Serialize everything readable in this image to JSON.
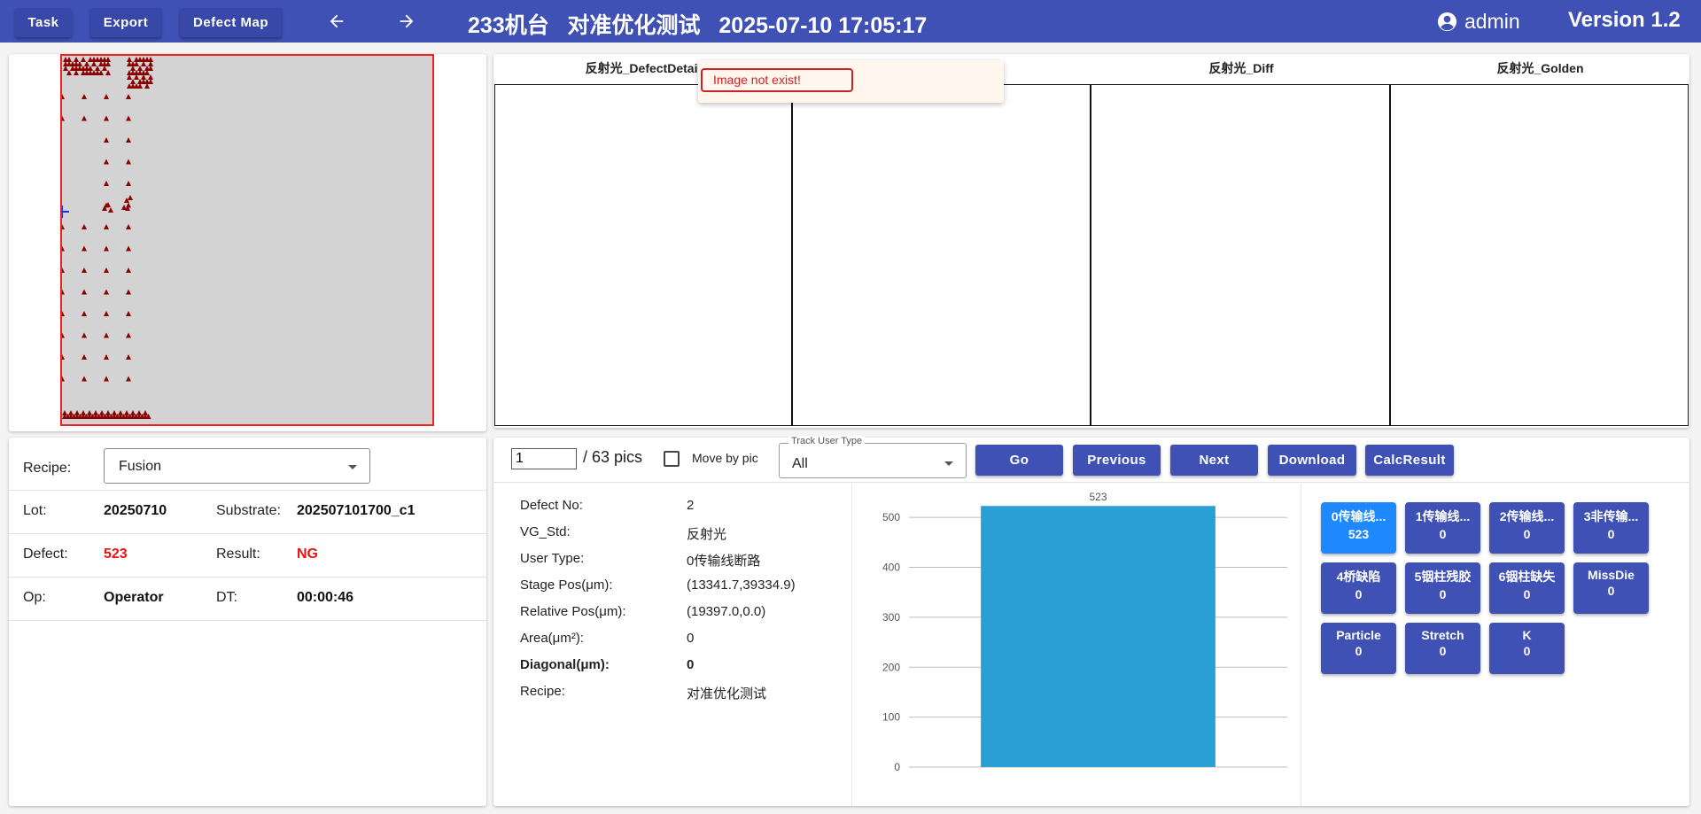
{
  "header": {
    "task_label": "Task",
    "export_label": "Export",
    "defect_map_label": "Defect Map",
    "title": "233机台   对准优化测试   2025-07-10 17:05:17",
    "user": "admin",
    "version": "Version 1.2",
    "background_color": "#3f51b5"
  },
  "info": {
    "recipe_label": "Recipe:",
    "recipe_value": "Fusion",
    "lot_label": "Lot:",
    "lot_value": "20250710",
    "substrate_label": "Substrate:",
    "substrate_value": "202507101700_c1",
    "defect_label": "Defect:",
    "defect_value": "523",
    "result_label": "Result:",
    "result_value": "NG",
    "op_label": "Op:",
    "op_value": "Operator",
    "dt_label": "DT:",
    "dt_value": "00:00:46"
  },
  "images": {
    "titles": [
      "反射光_DefectDetail",
      "",
      "反射光_Diff",
      "反射光_Golden"
    ],
    "toast": "Image not exist!"
  },
  "controls": {
    "page_value": "1",
    "pics_text": "/ 63 pics",
    "move_by_pic_label": "Move by pic",
    "move_by_pic_checked": false,
    "track_legend": "Track User Type",
    "track_value": "All",
    "go_label": "Go",
    "previous_label": "Previous",
    "next_label": "Next",
    "download_label": "Download",
    "calc_label": "CalcResult"
  },
  "details": [
    {
      "label": "Defect No:",
      "value": "2",
      "bold": false
    },
    {
      "label": "VG_Std:",
      "value": "反射光",
      "bold": false
    },
    {
      "label": "User Type:",
      "value": "0传输线断路",
      "bold": false
    },
    {
      "label": "Stage Pos(μm):",
      "value": "(13341.7,39334.9)",
      "bold": false
    },
    {
      "label": "Relative Pos(μm):",
      "value": "(19397.0,0.0)",
      "bold": false
    },
    {
      "label": "Area(μm²):",
      "value": "0",
      "bold": false
    },
    {
      "label": "Diagonal(μm):",
      "value": "0",
      "bold": true
    },
    {
      "label": "Recipe:",
      "value": "对准优化测试",
      "bold": false
    }
  ],
  "chart_data": {
    "type": "bar",
    "categories": [
      ""
    ],
    "values": [
      523
    ],
    "data_labels": [
      "523"
    ],
    "ylim": [
      0,
      550
    ],
    "yticks": [
      0,
      100,
      200,
      300,
      400,
      500
    ],
    "grid": true,
    "bar_color": "#2a9fd6"
  },
  "categories": [
    {
      "name": "0传输线断路",
      "display": "0传输线...",
      "count": "523",
      "active": true
    },
    {
      "name": "1传输线",
      "display": "1传输线...",
      "count": "0",
      "active": false
    },
    {
      "name": "2传输线",
      "display": "2传输线...",
      "count": "0",
      "active": false
    },
    {
      "name": "3非传输",
      "display": "3非传输...",
      "count": "0",
      "active": false
    },
    {
      "name": "4桥缺陷",
      "display": "4桥缺陷",
      "count": "0",
      "active": false
    },
    {
      "name": "5铟柱残胶",
      "display": "5铟柱残胶",
      "count": "0",
      "active": false
    },
    {
      "name": "6铟柱缺失",
      "display": "6铟柱缺失",
      "count": "0",
      "active": false
    },
    {
      "name": "MissDie",
      "display": "MissDie",
      "count": "0",
      "active": false
    },
    {
      "name": "Particle",
      "display": "Particle",
      "count": "0",
      "active": false
    },
    {
      "name": "Stretch",
      "display": "Stretch",
      "count": "0",
      "active": false
    },
    {
      "name": "K",
      "display": "K",
      "count": "0",
      "active": false
    }
  ]
}
